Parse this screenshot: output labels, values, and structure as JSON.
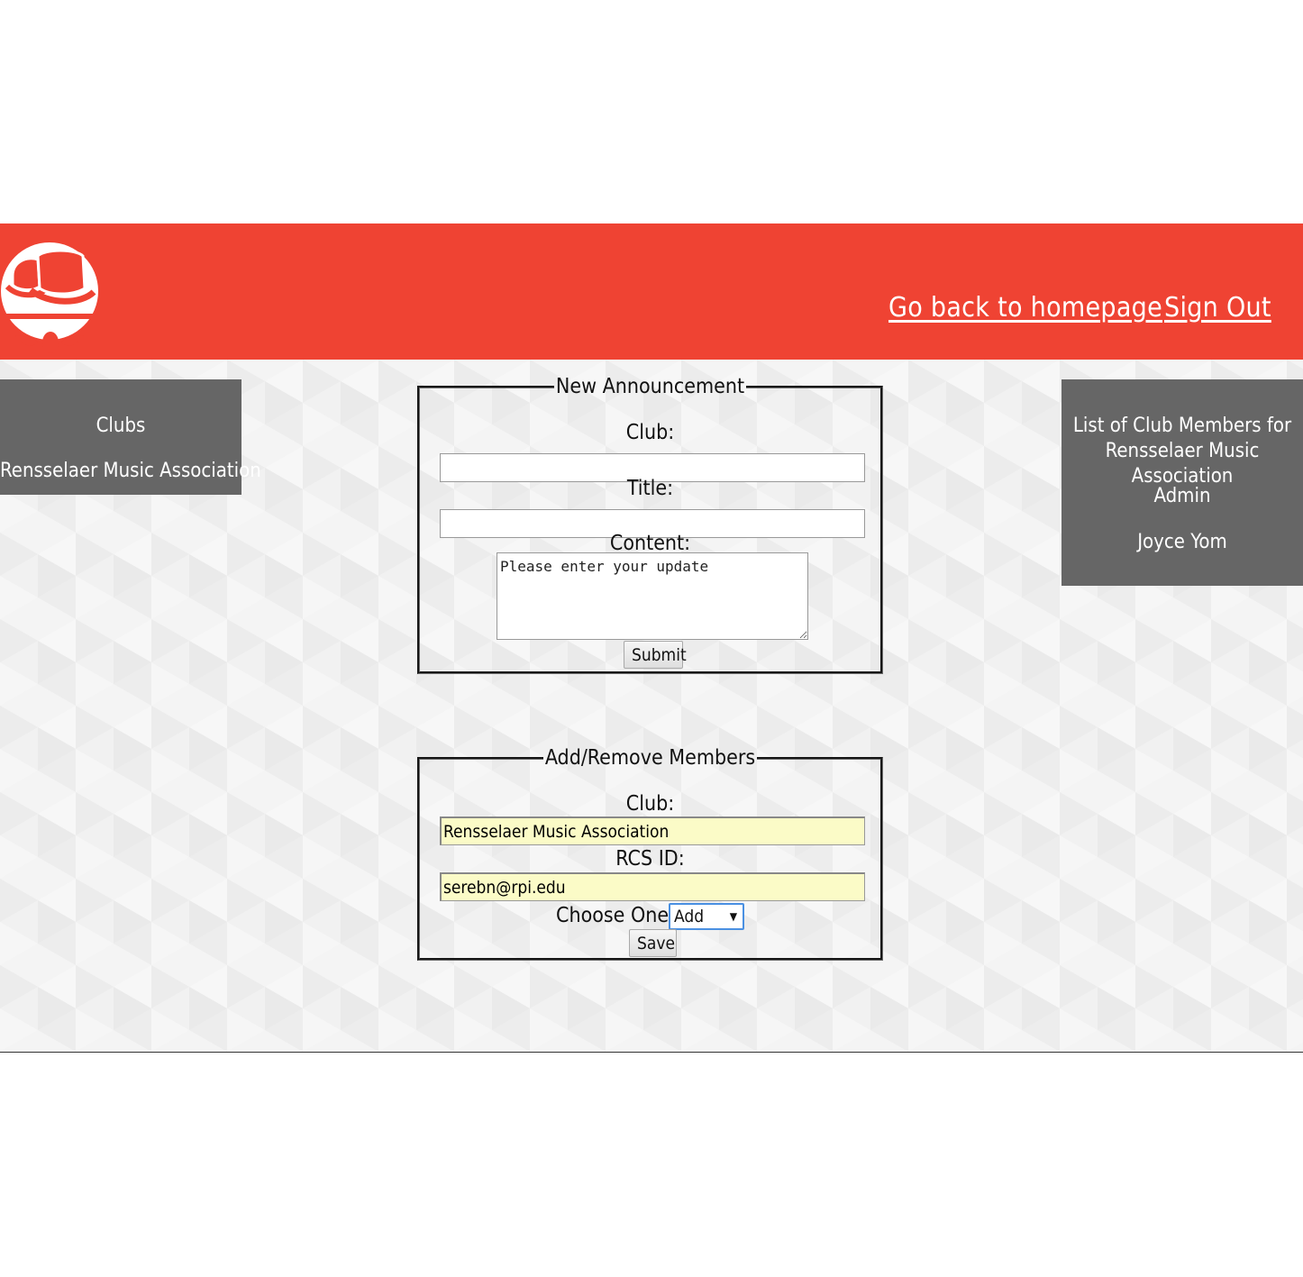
{
  "header": {
    "logo_icon": "top-hat-and-shoes-logo",
    "nav": {
      "home_label": "Go back to homepage",
      "signout_label": "Sign Out"
    },
    "color": "#ef4333"
  },
  "clubs_panel": {
    "title": "Clubs",
    "items": [
      "Rensselaer Music Association"
    ]
  },
  "members_panel": {
    "title": "List of Club Members for Rensselaer Music Association",
    "role": "Admin",
    "members": [
      "Joyce Yom"
    ]
  },
  "announcement_form": {
    "legend": "New Announcement",
    "club_label": "Club:",
    "club_value": "",
    "title_label": "Title:",
    "title_value": "",
    "content_label": "Content:",
    "content_value": "Please enter your update",
    "submit_label": "Submit"
  },
  "members_form": {
    "legend": "Add/Remove Members",
    "club_label": "Club:",
    "club_value": "Rensselaer Music Association",
    "rcs_label": "RCS ID:",
    "rcs_value": "serebn@rpi.edu",
    "choose_label": "Choose One:",
    "choose_value": "Add",
    "save_label": "Save"
  }
}
